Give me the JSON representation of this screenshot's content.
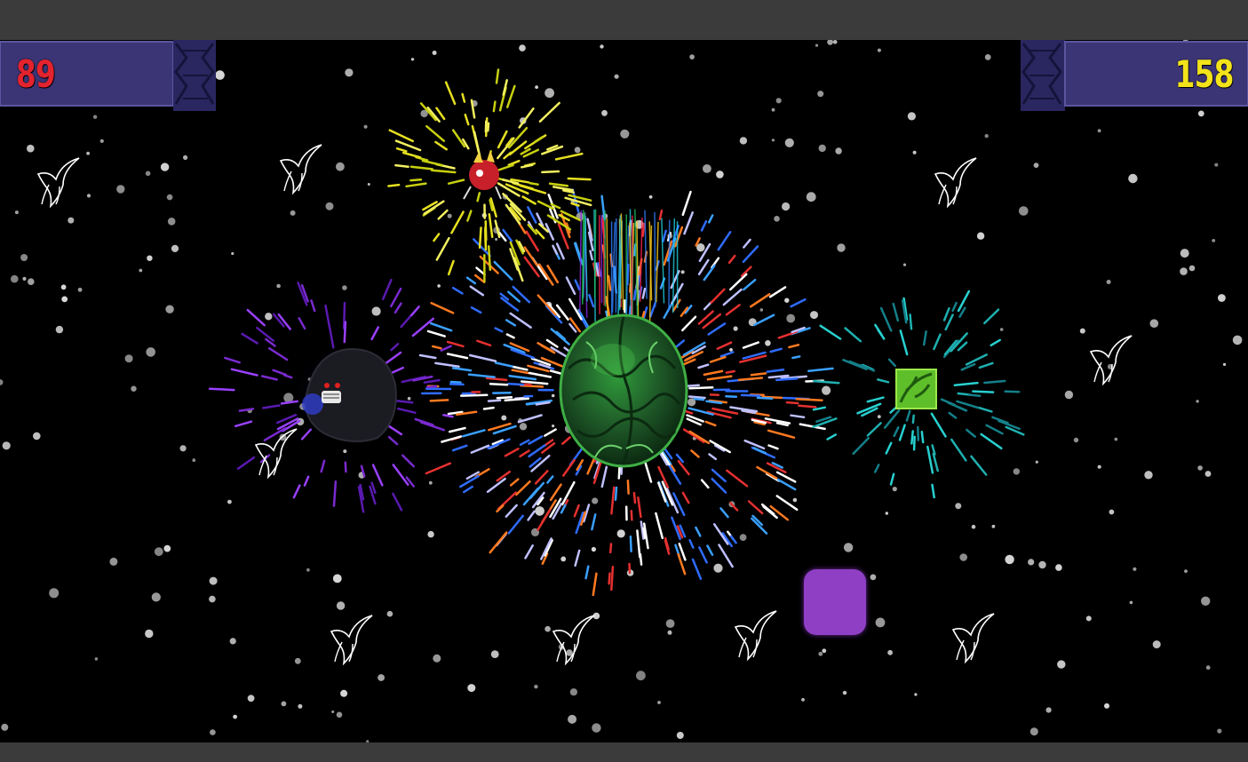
{
  "hud": {
    "left_score": "89",
    "right_score": "158",
    "left_score_color": "#e3232e",
    "right_score_color": "#f2e31a",
    "panel_color": "#3b3576"
  },
  "scene": {
    "background": "#000000",
    "letterbox_color": "#3b3b3b",
    "central_object": "green-brain-planet",
    "characters": [
      "hooded-reaper",
      "red-spiked-creature",
      "green-leaf-tile",
      "purple-block"
    ],
    "decorations": [
      "white-bird-sprites",
      "starfield",
      "firework-bursts"
    ]
  }
}
